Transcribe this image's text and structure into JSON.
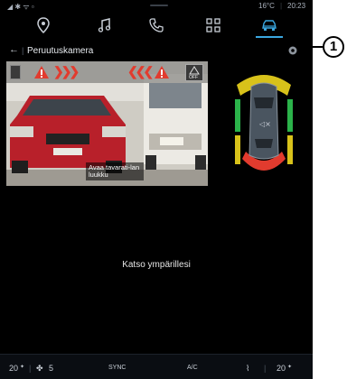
{
  "status_bar": {
    "temperature": "16°C",
    "time": "20:23"
  },
  "nav_icons": [
    "location-pin-icon",
    "music-note-icon",
    "phone-icon",
    "apps-grid-icon",
    "car-icon"
  ],
  "header": {
    "back_arrow": "←",
    "title": "Peruutuskamera"
  },
  "camera": {
    "overlay_text": "Avaa tavarati-lan luukku",
    "off_label": "OFF"
  },
  "main": {
    "message": "Katso ympärillesi"
  },
  "footer": {
    "left_temp": "20",
    "fan_level": "5",
    "sync_label": "SYNC",
    "ac_label": "A/C",
    "right_temp": "20"
  },
  "callout": {
    "number": "1"
  },
  "colors": {
    "accent": "#3aa7e0",
    "warning_red": "#e23b2e",
    "sensor_yellow": "#d8c21a",
    "sensor_green": "#2bb34a"
  }
}
